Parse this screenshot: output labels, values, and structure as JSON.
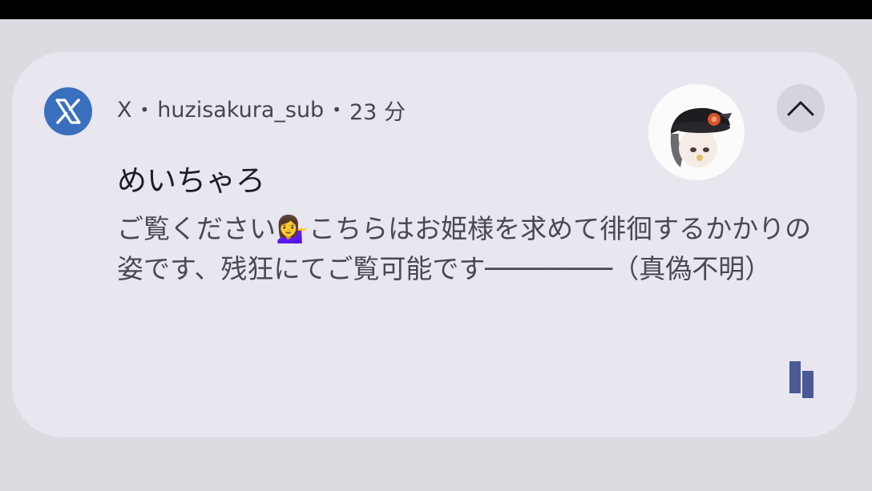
{
  "notification": {
    "app_name": "X",
    "account": "huzisakura_sub",
    "time": "23 分",
    "separator": "•",
    "title": "めいちゃろ",
    "body": "ご覧ください💁‍♀️こちらはお姫様を求めて徘徊するかかりの姿です、残狂にてご覧可能です────────（真偽不明）"
  },
  "icons": {
    "app_icon": "x-logo-icon",
    "expand": "chevron-up-icon",
    "badge": "app-badge-icon"
  },
  "colors": {
    "background": "#dddae1",
    "card": "#e8e6ee",
    "app_icon_bg": "#3a6fbd",
    "badge": "#4a5a96"
  }
}
